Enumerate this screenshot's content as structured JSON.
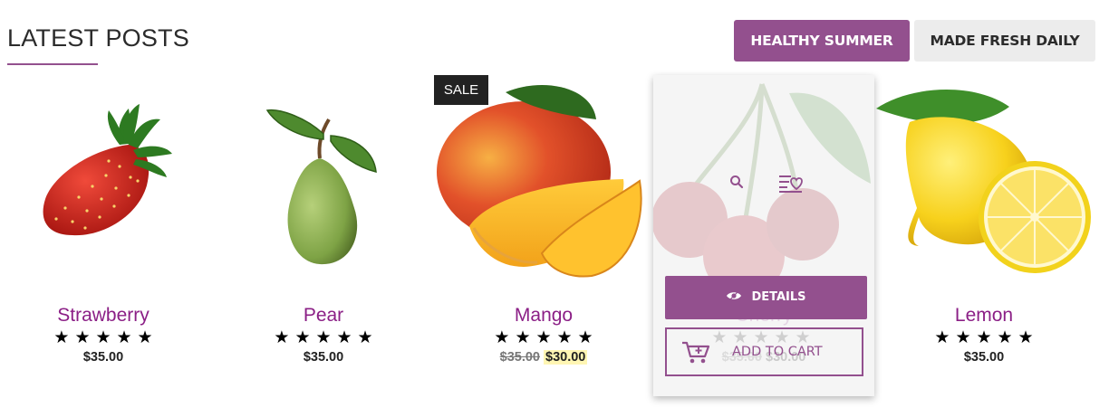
{
  "section": {
    "title": "LATEST POSTS"
  },
  "tabs": [
    {
      "label": "HEALTHY SUMMER",
      "active": true
    },
    {
      "label": "MADE FRESH DAILY",
      "active": false
    }
  ],
  "products": [
    {
      "name": "Strawberry",
      "stars": "★★★★★",
      "price": "$35.00",
      "image_icon": "strawberry-image"
    },
    {
      "name": "Pear",
      "stars": "★★★★★",
      "price": "$35.00",
      "image_icon": "pear-image"
    },
    {
      "name": "Mango",
      "stars": "★★★★★",
      "old_price": "$35.00",
      "new_price": "$30.00",
      "badge": "SALE",
      "image_icon": "mango-image"
    },
    {
      "name": "Cherry",
      "stars": "★★★★★",
      "old_price": "$35.00",
      "new_price": "$30.00",
      "image_icon": "cherry-image"
    },
    {
      "name": "Lemon",
      "stars": "★★★★★",
      "price": "$35.00",
      "image_icon": "lemon-image"
    }
  ],
  "hover_card": {
    "details_label": "DETAILS",
    "add_to_cart_label": "ADD TO CART",
    "icons": [
      "search-icon",
      "wishlist-icon",
      "eye-icon",
      "cart-icon"
    ]
  },
  "colors": {
    "accent": "#93508e",
    "product_name": "#8b1f86",
    "tab_inactive_bg": "#ececec",
    "badge_bg": "#222222",
    "sale_highlight": "#fff6b3"
  }
}
